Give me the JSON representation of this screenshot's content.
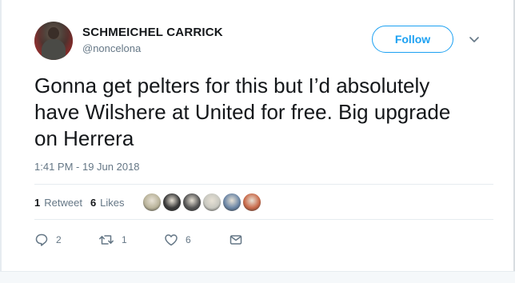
{
  "author": {
    "display_name": "SCHMEICHEL CARRICK",
    "handle": "@noncelona"
  },
  "follow_button": {
    "label": "Follow"
  },
  "tweet": {
    "text": "Gonna get pelters for this but I’d absolutely\nhave Wilshere at United for free. Big upgrade\non Herrera",
    "timestamp": "1:41 PM - 19 Jun 2018"
  },
  "stats": {
    "retweets_count": "1",
    "retweets_label": "Retweet",
    "likes_count": "6",
    "likes_label": "Likes"
  },
  "likers": [
    {
      "name": "liker-1",
      "color": "#b9b39a"
    },
    {
      "name": "liker-2",
      "color": "#3a3a3a"
    },
    {
      "name": "liker-3",
      "color": "#555555"
    },
    {
      "name": "liker-4",
      "color": "#c8c8c0"
    },
    {
      "name": "liker-5",
      "color": "#6b86a6"
    },
    {
      "name": "liker-6",
      "color": "#c96a4a"
    }
  ],
  "actions": {
    "reply_count": "2",
    "retweet_count": "1",
    "like_count": "6"
  },
  "colors": {
    "accent": "#1da1f2",
    "text": "#14171a",
    "muted": "#657786"
  }
}
